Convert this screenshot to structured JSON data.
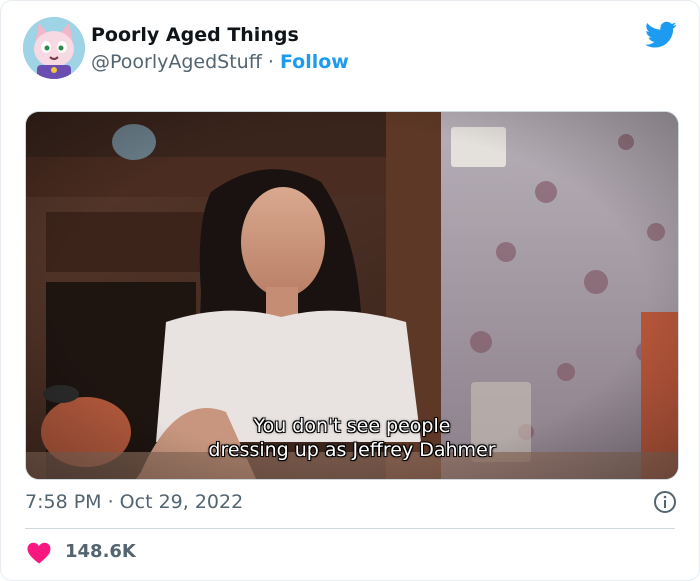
{
  "account": {
    "display_name": "Poorly Aged Things",
    "handle": "@PoorlyAgedStuff",
    "separator": " · ",
    "follow_label": "Follow",
    "avatar_icon": "cartoon-cat-avatar"
  },
  "brand": {
    "icon": "twitter-bird-icon",
    "color": "#1d9bf0"
  },
  "media": {
    "subtitle_line1": "You don't see people",
    "subtitle_line2": "dressing up as Jeffrey Dahmer"
  },
  "tweet": {
    "timestamp": "7:58 PM · Oct 29, 2022"
  },
  "engagement": {
    "likes": "148.6K",
    "heart_color": "#f91880"
  },
  "icons": {
    "info": "info-icon",
    "heart": "heart-icon"
  }
}
